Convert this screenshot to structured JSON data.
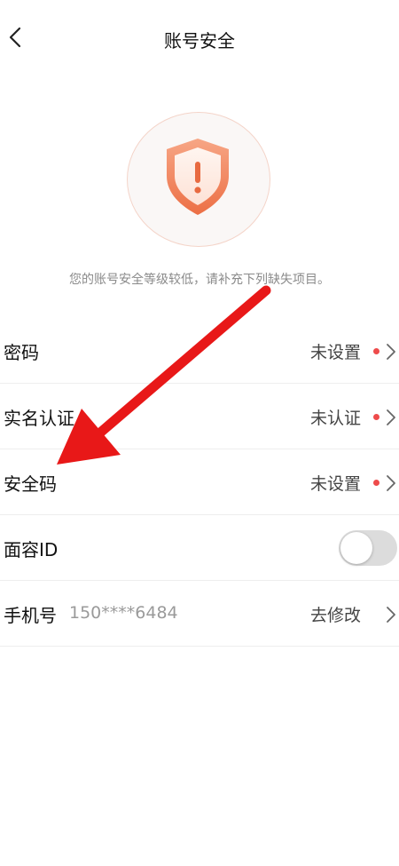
{
  "header": {
    "title": "账号安全",
    "back_icon": "chevron-left-icon"
  },
  "hero": {
    "shield_icon": "shield-exclamation-icon",
    "notice": "您的账号安全等级较低，请补充下列缺失项目。",
    "accent": "#f0825a"
  },
  "settings": {
    "password": {
      "label": "密码",
      "value": "未设置"
    },
    "real_name": {
      "label": "实名认证",
      "value": "未认证"
    },
    "security_code": {
      "label": "安全码",
      "value": "未设置"
    },
    "face_id": {
      "label": "面容ID",
      "enabled": false
    },
    "phone": {
      "label": "手机号",
      "number": "150****6484",
      "action": "去修改"
    }
  },
  "colors": {
    "status_dot": "#ee4b4b",
    "annotation_arrow": "#e81818"
  }
}
